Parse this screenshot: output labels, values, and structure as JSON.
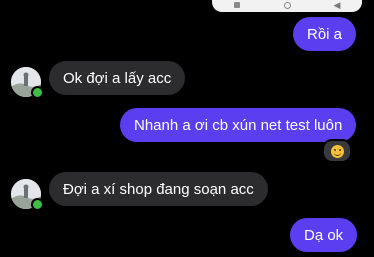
{
  "system_nav": {
    "recent_icon": "recent-apps-icon",
    "home_icon": "home-icon",
    "back_icon": "back-icon"
  },
  "messages": [
    {
      "sender": "me",
      "text": "Rồi a"
    },
    {
      "sender": "other",
      "text": "Ok đợi a lấy acc"
    },
    {
      "sender": "me",
      "text": "Nhanh a ơi cb xún net test luôn",
      "reaction": "smiling-face-emoji"
    },
    {
      "sender": "other",
      "text": "Đợi a xí shop đang soạn acc"
    },
    {
      "sender": "me",
      "text": "Dạ ok"
    }
  ],
  "colors": {
    "outgoing_bubble": "#5b3ef0",
    "incoming_bubble": "#2c2c2e",
    "background": "#000000",
    "online_indicator": "#3fbf4a"
  }
}
